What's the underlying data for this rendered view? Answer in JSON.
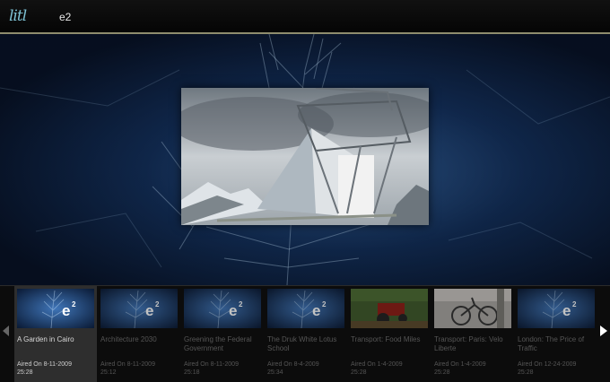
{
  "header": {
    "logo": "litl",
    "title": "e2"
  },
  "episodes": [
    {
      "title": "A Garden in Cairo",
      "aired": "Aired On 8-11-2009",
      "duration": "25:28",
      "thumb": "e2-logo",
      "selected": true
    },
    {
      "title": "Architecture 2030",
      "aired": "Aired On 8-11-2009",
      "duration": "25:12",
      "thumb": "e2-logo",
      "selected": false
    },
    {
      "title": "Greening the Federal Government",
      "aired": "Aired On 8-11-2009",
      "duration": "25:18",
      "thumb": "e2-logo",
      "selected": false
    },
    {
      "title": "The Druk White Lotus School",
      "aired": "Aired On 8-4-2009",
      "duration": "25:34",
      "thumb": "e2-logo",
      "selected": false
    },
    {
      "title": "Transport: Food Miles",
      "aired": "Aired On 1-4-2009",
      "duration": "25:28",
      "thumb": "tractor-photo",
      "selected": false
    },
    {
      "title": "Transport: Paris: Velo Liberte",
      "aired": "Aired On 1-4-2009",
      "duration": "25:28",
      "thumb": "bicycle-photo",
      "selected": false
    },
    {
      "title": "London: The Price of Traffic",
      "aired": "Aired On 12-24-2009",
      "duration": "25:28",
      "thumb": "e2-logo",
      "selected": false
    }
  ],
  "colors": {
    "accent": "#7ec2d4",
    "divider": "#8f8d6e",
    "selected": "#2e2e2e"
  },
  "icons": {
    "prev": "triangle-left-icon",
    "next": "triangle-right-icon"
  }
}
